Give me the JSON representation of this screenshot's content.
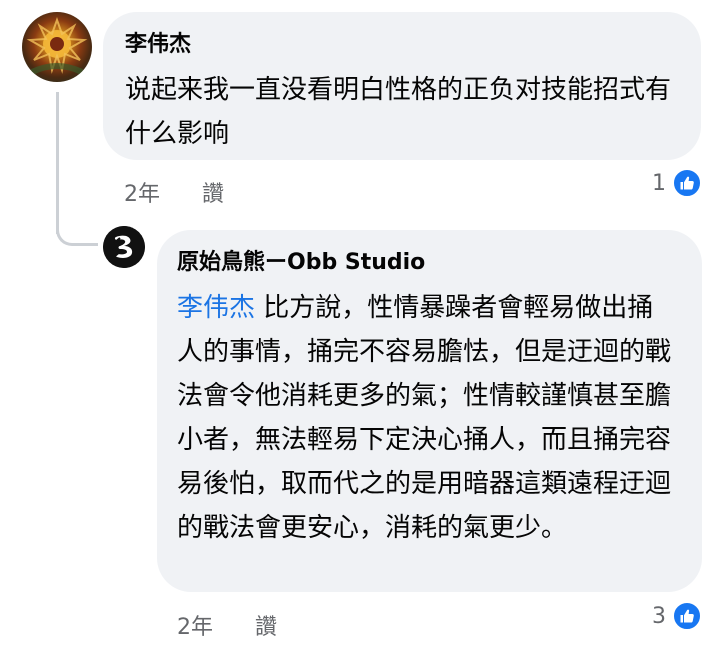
{
  "comments": [
    {
      "author": "李伟杰",
      "text": "说起来我一直没看明白性格的正负对技能招式有什么影响",
      "time": "2年",
      "like_label": "讚",
      "reaction_count": "1",
      "reaction_icon": "thumbs-up-icon"
    }
  ],
  "replies": [
    {
      "author": "原始鳥熊ーObb Studio",
      "mention": "李伟杰",
      "text": " 比方說，性情暴躁者會輕易做出捅人的事情，捅完不容易膽怯，但是迂迴的戰法會令他消耗更多的氣；性情較謹慎甚至膽小者，無法輕易下定決心捅人，而且捅完容易後怕，取而代之的是用暗器這類遠程迂迴的戰法會更安心，消耗的氣更少。",
      "time": "2年",
      "like_label": "讚",
      "reaction_count": "3",
      "reaction_icon": "thumbs-up-icon"
    }
  ],
  "colors": {
    "bubble_bg": "#f0f2f5",
    "mention": "#1b74e4",
    "like_blue": "#1877f2",
    "meta_gray": "#65676b",
    "thread_line": "#ccd0d5"
  }
}
